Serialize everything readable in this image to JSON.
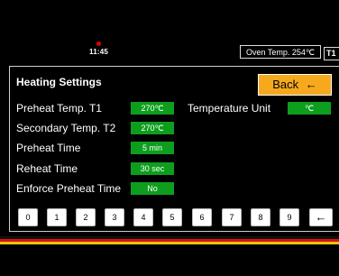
{
  "status_bar": {
    "clock": "11:45",
    "oven_temp": "Oven Temp. 254℃",
    "oven_tag": "T1"
  },
  "panel": {
    "title": "Heating Settings",
    "back_label": "Back",
    "back_arrow": "←",
    "rows": [
      {
        "label": "Preheat Temp. T1",
        "value": "270℃"
      },
      {
        "label": "Secondary Temp. T2",
        "value": "270℃"
      },
      {
        "label": "Preheat Time",
        "value": "5 min"
      },
      {
        "label": "Reheat Time",
        "value": "30 sec"
      },
      {
        "label": "Enforce Preheat Time",
        "value": "No"
      }
    ],
    "temperature_unit": {
      "label": "Temperature Unit",
      "value": "℃"
    }
  },
  "keypad": {
    "keys": [
      "0",
      "1",
      "2",
      "3",
      "4",
      "5",
      "6",
      "7",
      "8",
      "9",
      "←"
    ]
  },
  "colors": {
    "background": "#000000",
    "value_green": "#0e9e1d",
    "back_orange": "#f7a91d",
    "status_dot": "#e00000",
    "stripe_red": "#d8141a",
    "stripe_yellow": "#f7c012"
  }
}
